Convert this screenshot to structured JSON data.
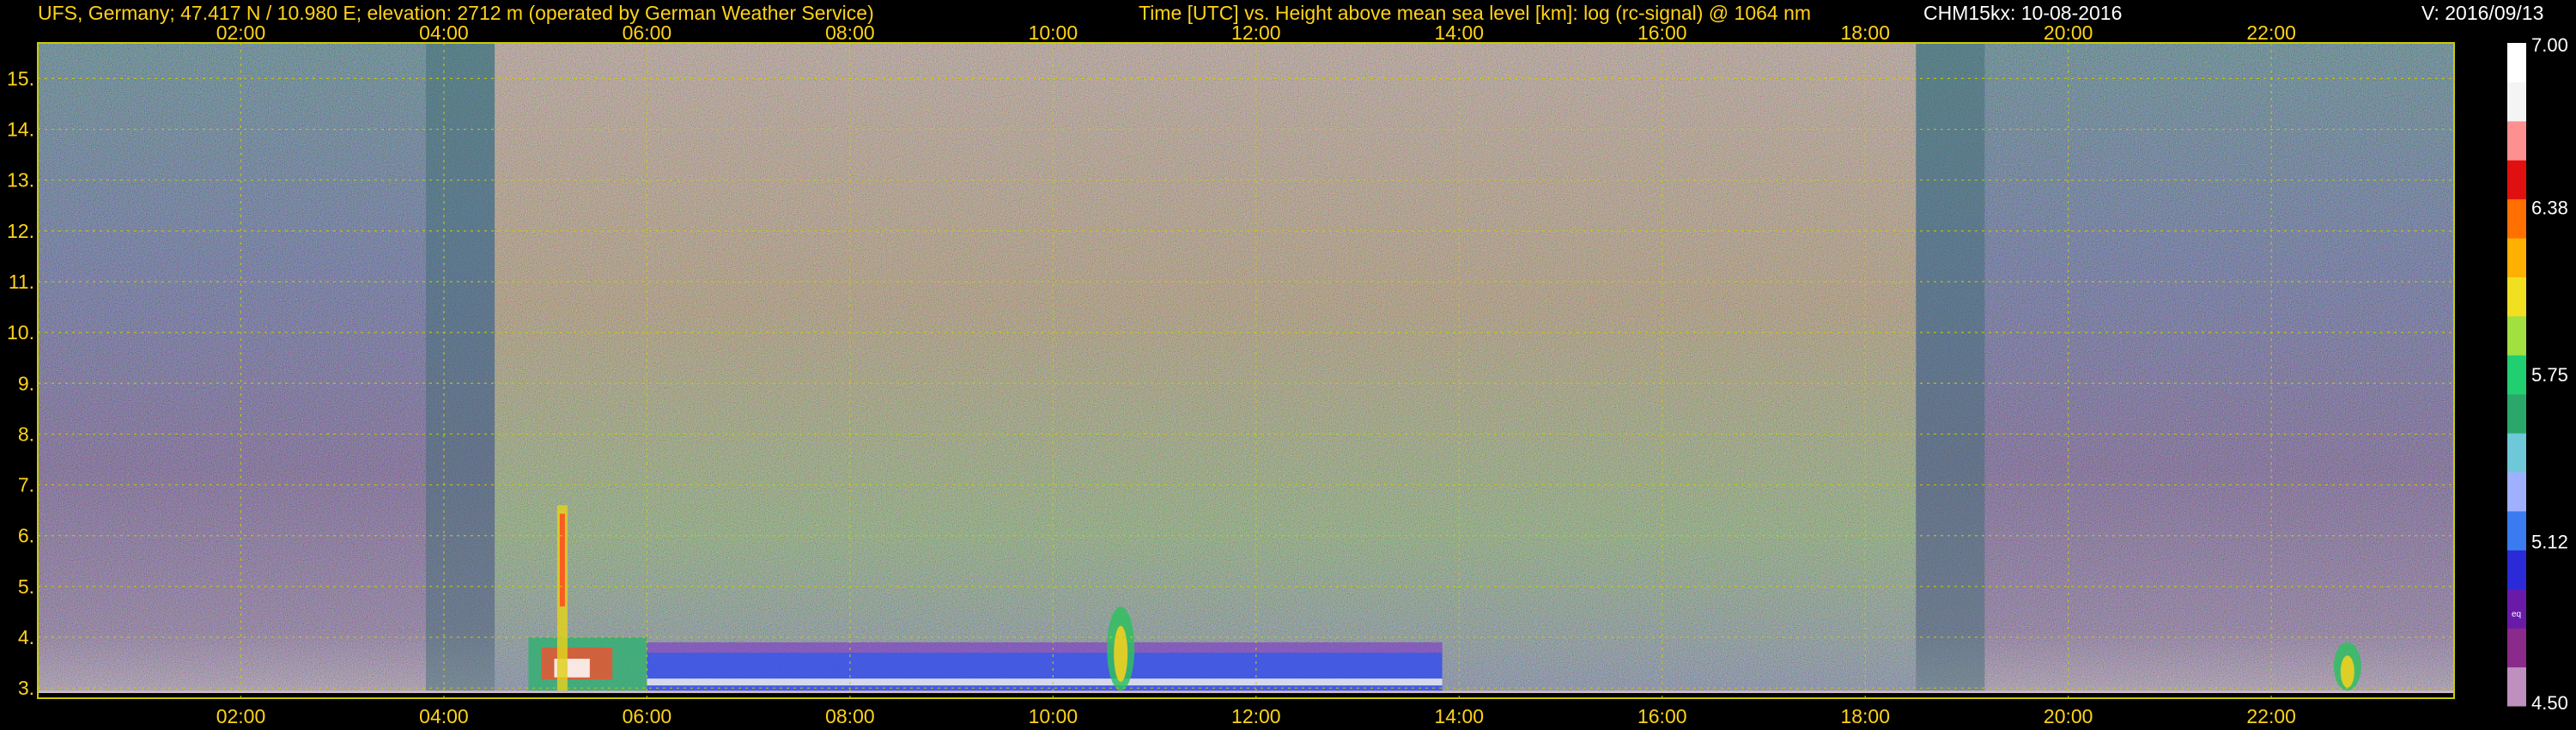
{
  "header": {
    "station": "UFS, Germany; 47.417 N / 10.980 E; elevation: 2712 m  (operated by German Weather Service)",
    "plot_title": "Time [UTC] vs. Height above mean sea level [km]: log (rc-signal) @ 1064 nm",
    "instrument": "CHM15kx: 10-08-2016",
    "version": "V: 2016/09/13"
  },
  "colors": {
    "text": "#ffd21a",
    "grid": "#cccc00",
    "background": "#000000",
    "colormap": [
      "#bf8fbf",
      "#8a2a8a",
      "#6a1aa8",
      "#2a2ad8",
      "#3a7cf0",
      "#9fb0ff",
      "#6fc8d8",
      "#2aa86a",
      "#20d070",
      "#a0e040",
      "#f0e020",
      "#ffb000",
      "#ff7000",
      "#e01010",
      "#ff9090",
      "#f4f4f4",
      "#ffffff"
    ]
  },
  "chart_data": {
    "type": "heatmap",
    "title": "Time [UTC] vs. Height above mean sea level [km]: log (rc-signal) @ 1064 nm",
    "xlabel": "Time [UTC]",
    "ylabel": "Height above mean sea level [km]",
    "xlim": [
      0.0,
      23.8
    ],
    "ylim": [
      2.8,
      15.7
    ],
    "x_ticks": [
      "02:00",
      "04:00",
      "06:00",
      "08:00",
      "10:00",
      "12:00",
      "14:00",
      "16:00",
      "18:00",
      "20:00",
      "22:00"
    ],
    "x_tick_values": [
      2,
      4,
      6,
      8,
      10,
      12,
      14,
      16,
      18,
      20,
      22
    ],
    "y_ticks": [
      "3.",
      "4.",
      "5.",
      "6.",
      "7.",
      "8.",
      "9.",
      "10.",
      "11.",
      "12.",
      "13.",
      "14.",
      "15."
    ],
    "y_tick_values": [
      3,
      4,
      5,
      6,
      7,
      8,
      9,
      10,
      11,
      12,
      13,
      14,
      15
    ],
    "grid": true,
    "colorbar": {
      "min": 4.5,
      "max": 7.0,
      "labels": [
        "7.00",
        "6.38",
        "5.75",
        "5.12",
        "4.50"
      ],
      "label_values": [
        7.0,
        6.38,
        5.75,
        5.12,
        4.5
      ],
      "note": "eq"
    },
    "features": [
      {
        "name": "daylight background",
        "start_time": "04:30",
        "end_time": "18:30"
      },
      {
        "name": "low cloud layer",
        "start_time": "04:50",
        "end_time": "06:00",
        "top_km": 4.0
      },
      {
        "name": "convective plume",
        "time": "05:10",
        "top_km": 6.6
      },
      {
        "name": "boundary layer aerosol",
        "start_time": "06:00",
        "end_time": "13:50",
        "top_km": 3.9
      },
      {
        "name": "cloud",
        "time": "10:40",
        "top_km": 4.6
      },
      {
        "name": "cloud",
        "time": "22:45",
        "top_km": 3.9
      }
    ]
  }
}
